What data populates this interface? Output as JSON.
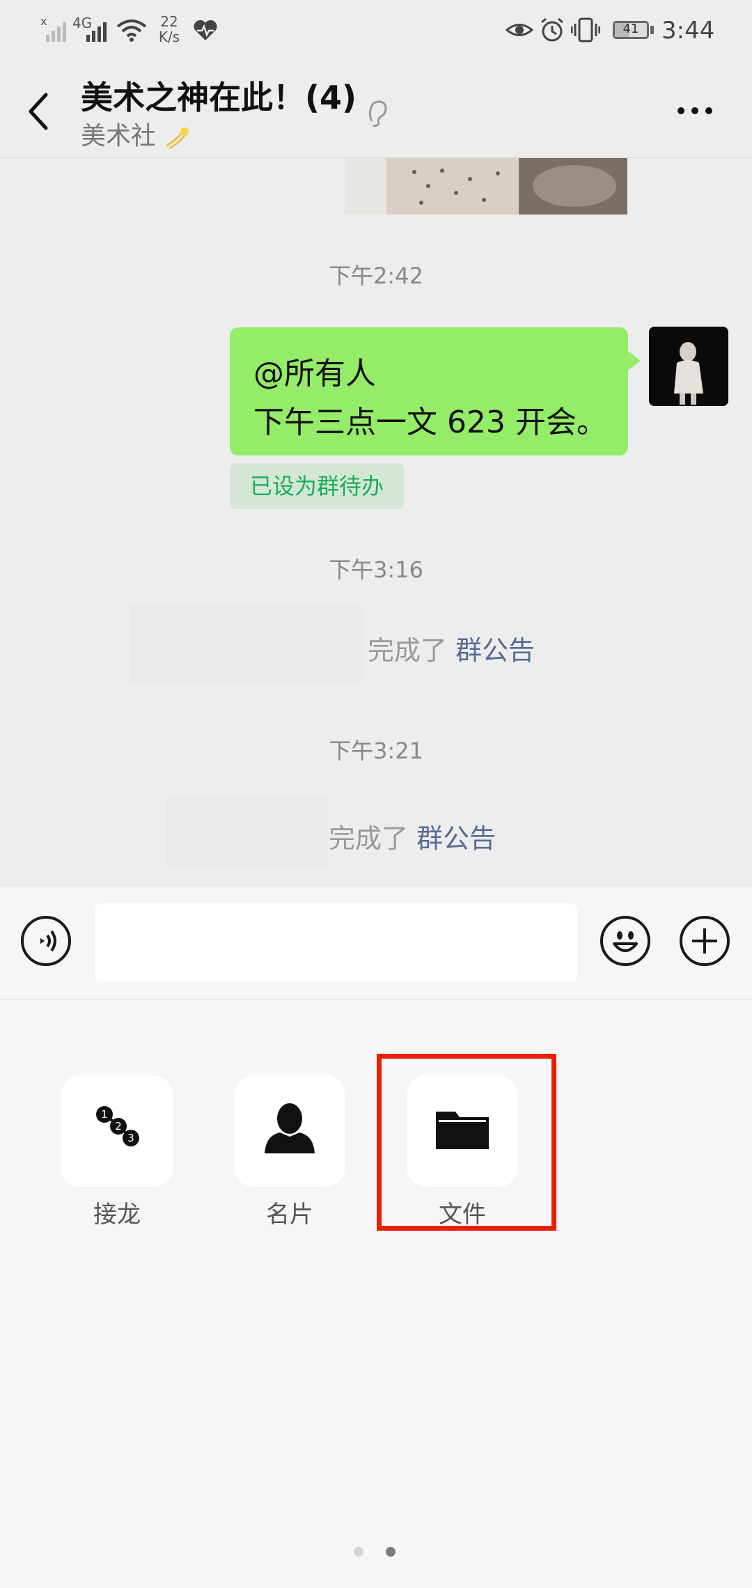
{
  "status_bar": {
    "network_type": "4G",
    "speed_value": "22",
    "speed_unit": "K/s",
    "battery": "41",
    "time": "3:44"
  },
  "header": {
    "title": "美术之神在此！(4)",
    "subtitle": "美术社"
  },
  "chat": {
    "messages": [
      {
        "type": "time",
        "text": "下午2:42"
      },
      {
        "type": "outgoing",
        "line1": "@所有人",
        "line2": "下午三点一文 623 开会。",
        "badge": "已设为群待办"
      },
      {
        "type": "time",
        "text": "下午3:16"
      },
      {
        "type": "system",
        "text": "完成了",
        "link": "群公告"
      },
      {
        "type": "time",
        "text": "下午3:21"
      },
      {
        "type": "system",
        "text": "完成了",
        "link": "群公告"
      }
    ]
  },
  "input_bar": {
    "icons": [
      "voice-icon",
      "emoji-icon",
      "plus-icon"
    ]
  },
  "panel": {
    "items": [
      {
        "label": "接龙",
        "icon": "solitaire-icon"
      },
      {
        "label": "名片",
        "icon": "contact-card-icon"
      },
      {
        "label": "文件",
        "icon": "folder-icon"
      }
    ],
    "page_count": 2,
    "current_page": 2
  },
  "colors": {
    "bubble": "#95ec69",
    "link": "#576b95",
    "todo_text": "#1aad58",
    "highlight": "#e8200a"
  }
}
